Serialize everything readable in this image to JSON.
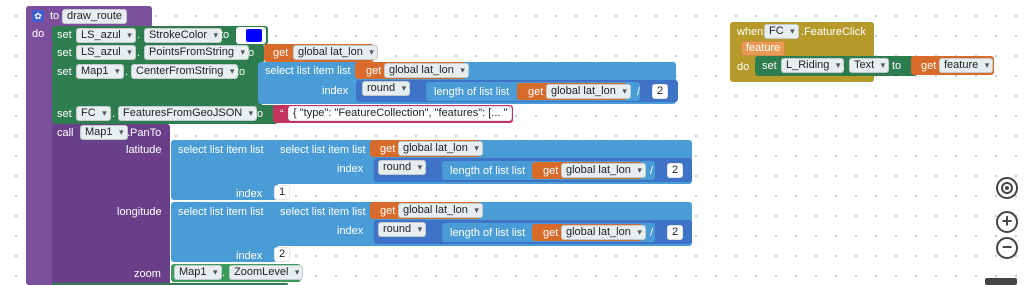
{
  "procedure": {
    "to_label": "to",
    "name": "draw_route",
    "do_label": "do"
  },
  "keywords": {
    "set": "set",
    "to": "to",
    "get": "get",
    "call": "call",
    "select_list_item": "select list item  list",
    "index": "index",
    "round": "round",
    "length_of_list": "length of list  list",
    "divide": "/",
    "dot": "."
  },
  "components": {
    "ls_azul": "LS_azul",
    "map1": "Map1",
    "fc": "FC",
    "l_riding": "L_Riding"
  },
  "properties": {
    "stroke_color": "StrokeColor",
    "points_from_string": "PointsFromString",
    "center_from_string": "CenterFromString",
    "features_from_geojson": "FeaturesFromGeoJSON",
    "zoom_level": "ZoomLevel",
    "text": "Text"
  },
  "variables": {
    "global_lat_lon": "global lat_lon",
    "feature": "feature"
  },
  "values": {
    "two": "2",
    "one": "1",
    "geojson": "{ \"type\": \"FeatureCollection\",  \"features\": [... \""
  },
  "colors": {
    "stroke_color_swatch": "#0000ff"
  },
  "pan_to": {
    "method": ".PanTo",
    "latitude": "latitude",
    "longitude": "longitude",
    "zoom": "zoom"
  },
  "event": {
    "when_label": "when",
    "event_name": ".FeatureClick",
    "param": "feature",
    "do_label": "do"
  },
  "map_controls": {
    "locate_icon": "target-icon",
    "zoom_in": "+",
    "zoom_out": "−"
  }
}
